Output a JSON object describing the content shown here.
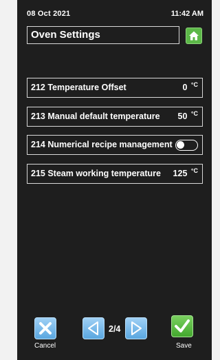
{
  "header": {
    "date": "08 Oct 2021",
    "time": "11:42 AM"
  },
  "title": "Oven Settings",
  "settings": [
    {
      "label": "212 Temperature Offset",
      "value": "0",
      "unit": "°C"
    },
    {
      "label": "213 Manual default temperature",
      "value": "50",
      "unit": "°C"
    },
    {
      "label": "214 Numerical recipe management",
      "toggle": "off"
    },
    {
      "label": "215 Steam working temperature",
      "value": "125",
      "unit": "°C"
    }
  ],
  "footer": {
    "cancel_label": "Cancel",
    "page_indicator": "2/4",
    "save_label": "Save"
  },
  "colors": {
    "background": "#1e1e1e",
    "accent_green": "#5cb848",
    "accent_blue": "#5aa7e0"
  },
  "icons": [
    "home-icon",
    "cancel-x-icon",
    "arrow-left-icon",
    "arrow-right-icon",
    "checkmark-icon"
  ]
}
